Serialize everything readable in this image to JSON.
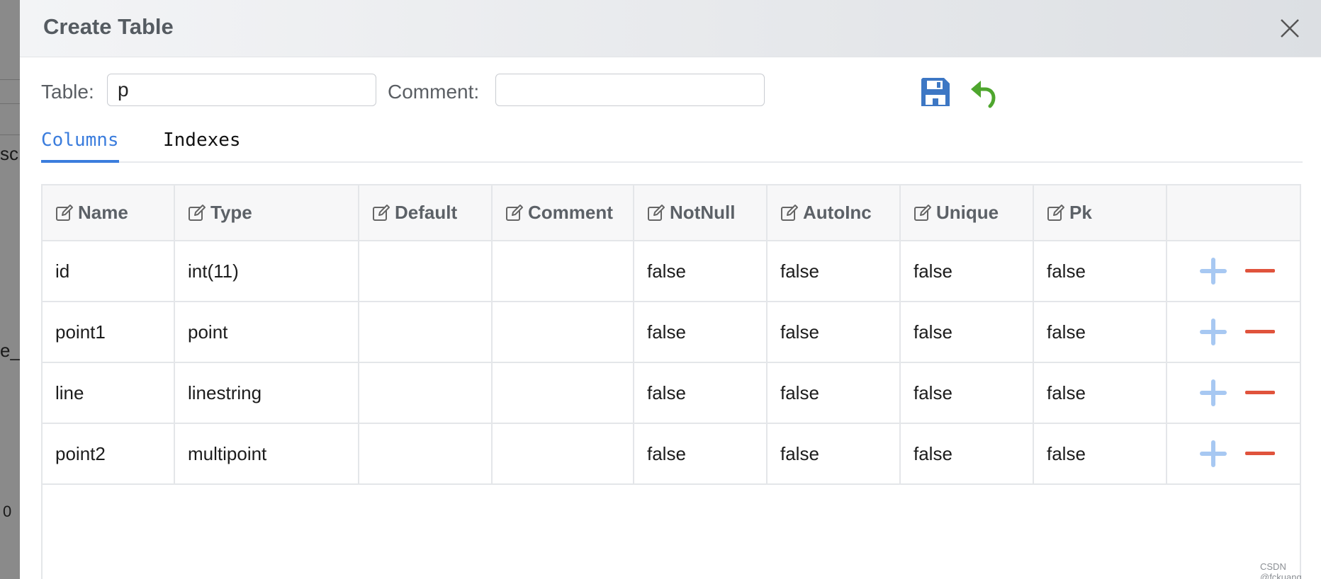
{
  "background": {
    "fragments": [
      "sc",
      "e_s",
      "0"
    ]
  },
  "dialog": {
    "title": "Create Table",
    "close_icon": "close-icon"
  },
  "toolbar": {
    "table_label": "Table:",
    "table_value": "p",
    "comment_label": "Comment:",
    "comment_value": "",
    "save_icon": "save-icon",
    "undo_icon": "undo-icon",
    "colors": {
      "save": "#3d77c4",
      "undo": "#4ea62e"
    }
  },
  "tabs": [
    {
      "label": "Columns",
      "active": true
    },
    {
      "label": "Indexes",
      "active": false
    }
  ],
  "grid": {
    "columns": [
      "Name",
      "Type",
      "Default",
      "Comment",
      "NotNull",
      "AutoInc",
      "Unique",
      "Pk"
    ],
    "rows": [
      {
        "Name": "id",
        "Type": "int(11)",
        "Default": "",
        "Comment": "",
        "NotNull": "false",
        "AutoInc": "false",
        "Unique": "false",
        "Pk": "false"
      },
      {
        "Name": "point1",
        "Type": "point",
        "Default": "",
        "Comment": "",
        "NotNull": "false",
        "AutoInc": "false",
        "Unique": "false",
        "Pk": "false"
      },
      {
        "Name": "line",
        "Type": "linestring",
        "Default": "",
        "Comment": "",
        "NotNull": "false",
        "AutoInc": "false",
        "Unique": "false",
        "Pk": "false"
      },
      {
        "Name": "point2",
        "Type": "multipoint",
        "Default": "",
        "Comment": "",
        "NotNull": "false",
        "AutoInc": "false",
        "Unique": "false",
        "Pk": "false"
      }
    ],
    "row_actions": {
      "add_icon": "plus-icon",
      "remove_icon": "minus-icon"
    },
    "colors": {
      "add": "#a7c8f2",
      "remove": "#e0533c"
    }
  },
  "watermark": "CSDN @fckuang"
}
